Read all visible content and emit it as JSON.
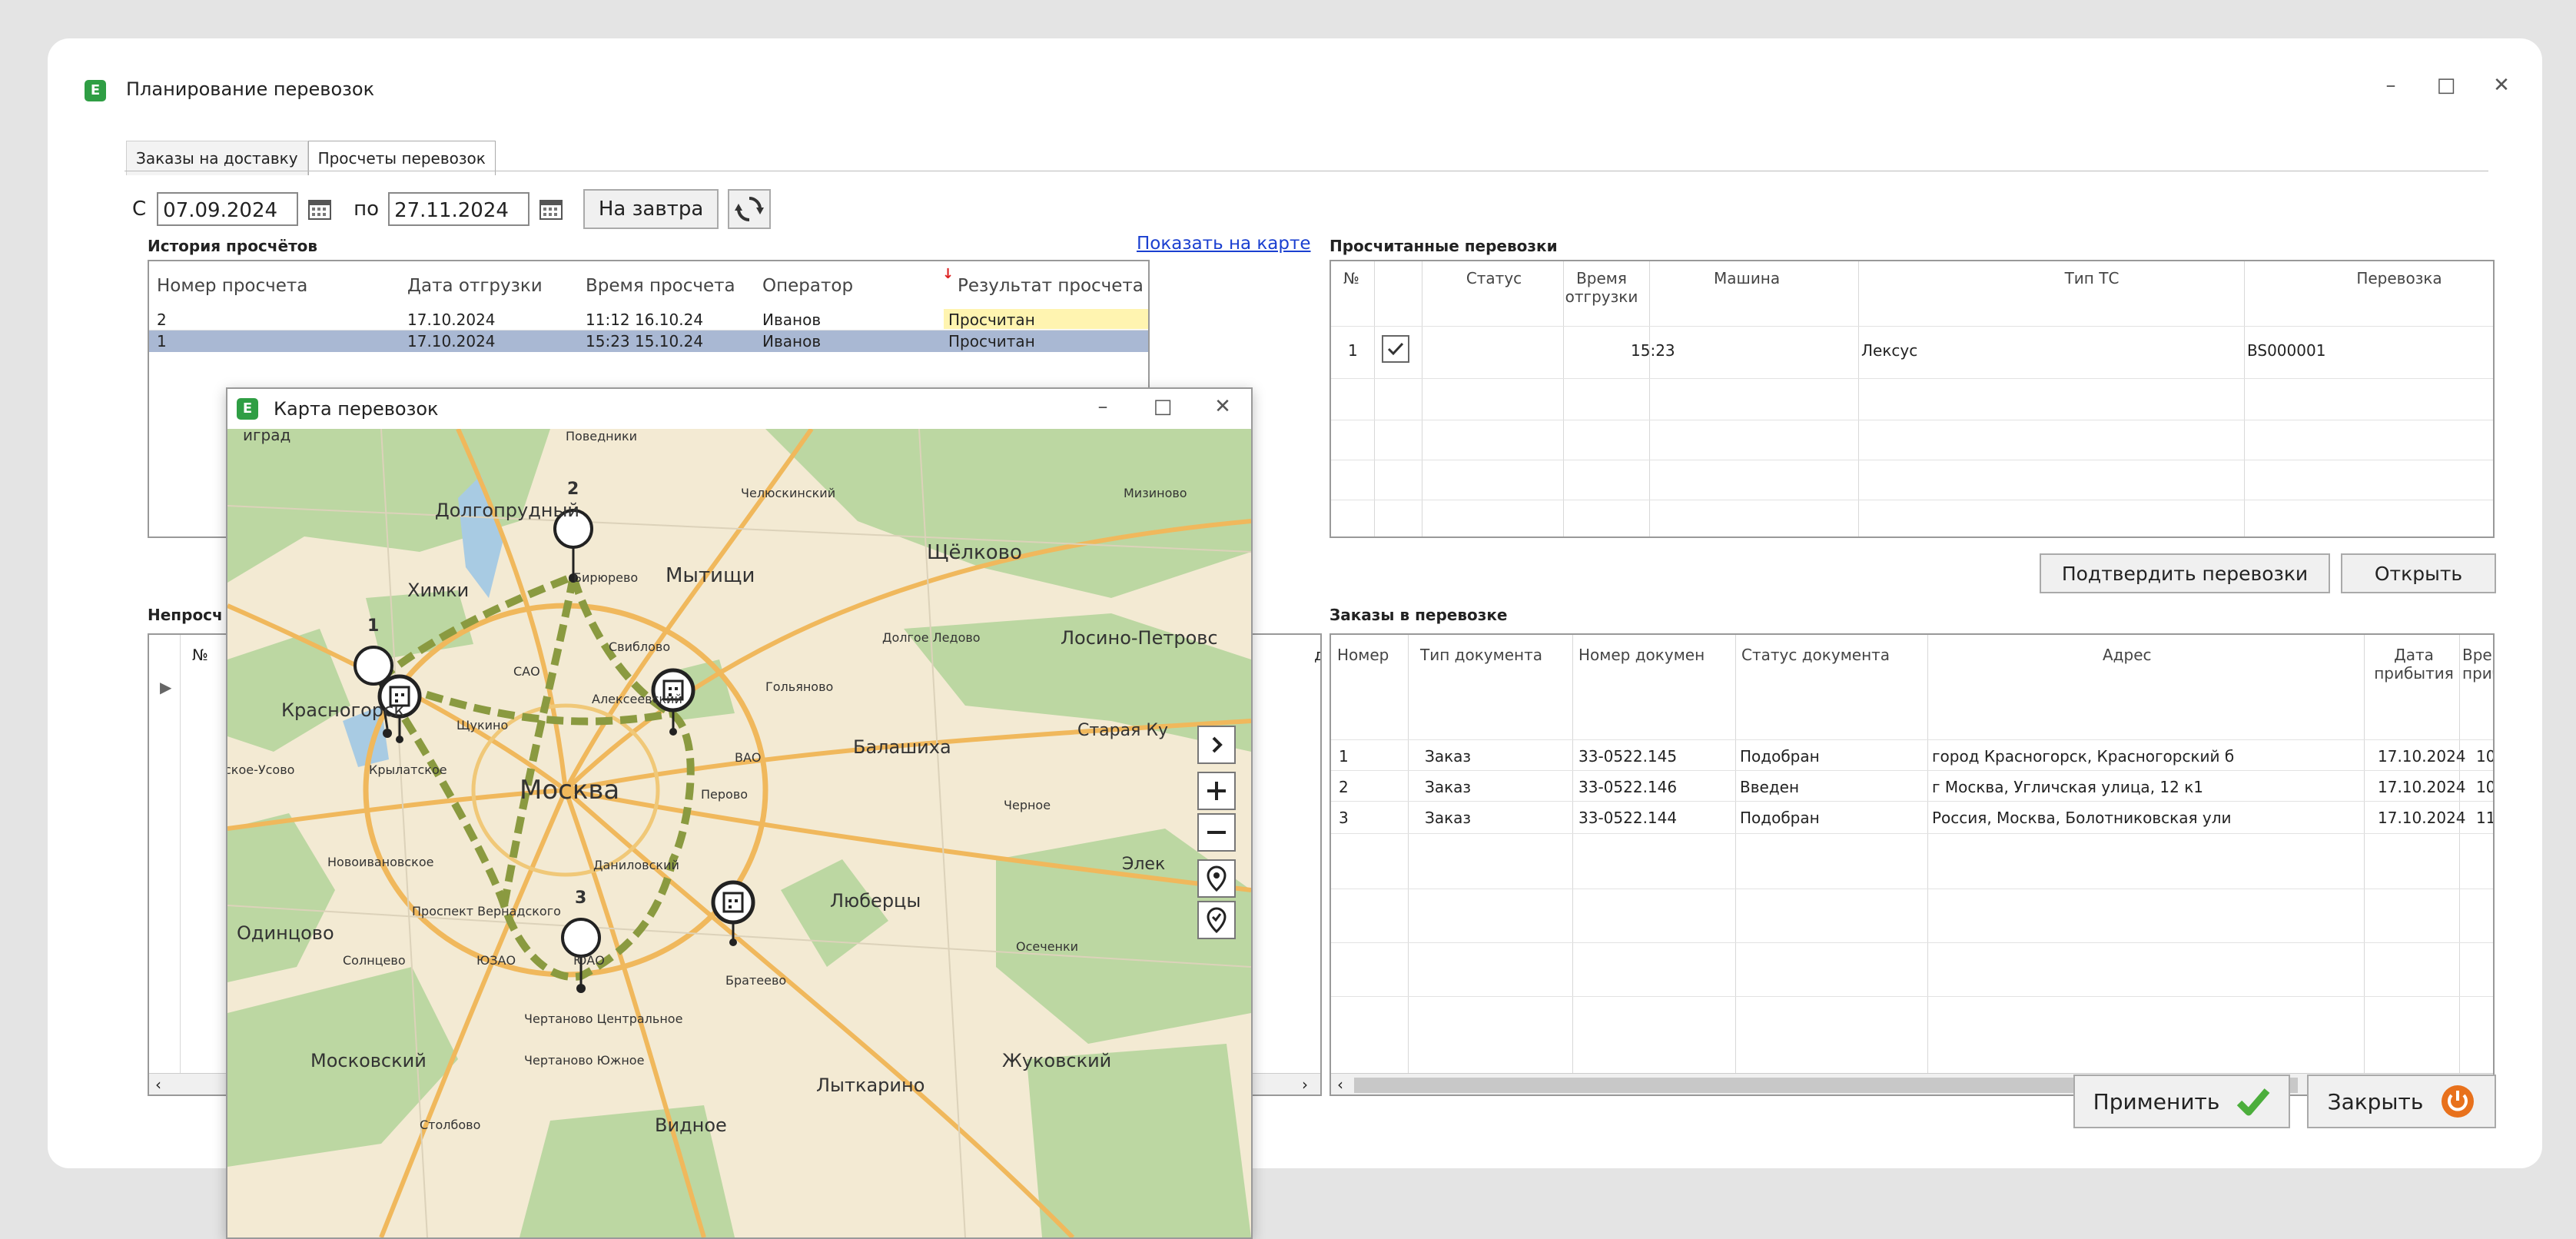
{
  "window": {
    "title": "Планирование перевозок",
    "minimize": "–",
    "maximize": "□",
    "close": "✕",
    "app_icon": "E"
  },
  "tabs": [
    {
      "label": "Заказы на доставку"
    },
    {
      "label": "Просчеты перевозок"
    }
  ],
  "filters": {
    "from_label": "С",
    "from_date": "07.09.2024",
    "to_label": "по",
    "to_date": "27.11.2024",
    "tomorrow_button": "На завтра"
  },
  "history": {
    "title": "История просчётов",
    "show_map_link": "Показать на карте",
    "columns": [
      "Номер просчета",
      "Дата отгрузки",
      "Время просчета",
      "Оператор",
      "Результат просчета"
    ],
    "sort_marker": "↓",
    "rows": [
      [
        "2",
        "17.10.2024",
        "11:12  16.10.24",
        "Иванов",
        "Просчитан"
      ],
      [
        "1",
        "17.10.2024",
        "15:23  15.10.24",
        "Иванов",
        "Просчитан"
      ]
    ]
  },
  "calculated": {
    "title": "Просчитанные перевозки",
    "columns": [
      "№",
      "Статус",
      "Время отгрузки",
      "Машина",
      "Тип ТС",
      "Перевозка"
    ],
    "rows": [
      {
        "n": "1",
        "time": "15:23",
        "vehicle_type": "Лексус",
        "transport": "BS000001"
      }
    ],
    "confirm_button": "Подтвердить перевозки",
    "open_button": "Открыть"
  },
  "uncalculated": {
    "title_partial": "Непросч",
    "col_n": "№",
    "col_addr_partial": "дрес"
  },
  "orders": {
    "title": "Заказы в перевозке",
    "columns": [
      "Номер",
      "Тип документа",
      "Номер докумен",
      "Статус документа",
      "Адрес",
      "Дата прибытия",
      "Время прибыт"
    ],
    "rows": [
      [
        "1",
        "Заказ",
        "33-0522.145",
        "Подобран",
        "город Красногорск, Красногорский б",
        "17.10.2024",
        "10"
      ],
      [
        "2",
        "Заказ",
        "33-0522.146",
        "Введен",
        "г Москва, Угличская улица, 12 к1",
        "17.10.2024",
        "10"
      ],
      [
        "3",
        "Заказ",
        "33-0522.144",
        "Подобран",
        "Россия, Москва, Болотниковская ули",
        "17.10.2024",
        "11"
      ]
    ]
  },
  "bottom": {
    "apply_button": "Применить",
    "close_button": "Закрыть"
  },
  "map_window": {
    "title": "Карта перевозок",
    "markers": [
      "1",
      "2",
      "3"
    ],
    "labels": {
      "moscow": "Москва",
      "khimki": "Химки",
      "dolgoprudny": "Долгопрудный",
      "mytishchi": "Мытищи",
      "shchelkovo": "Щёлково",
      "krasnogorsk": "Красногорск",
      "balashikha": "Балашиха",
      "lyubertsy": "Люберцы",
      "odintsovo": "Одинцово",
      "moskovsky": "Московский",
      "zhukovsky": "Жуковский",
      "lytkarino": "Лыткарино",
      "losino": "Лосино-Петровс",
      "staraya": "Старая Ку",
      "elek": "Элек",
      "vidnoe": "Видное",
      "chelyuskinsky": "Челюскинский",
      "mizinovo": "Мизиново",
      "dolgoe": "Долгое Ледово",
      "povedniki": "Поведники",
      "sviblovo": "Свиблово",
      "alekseevsky": "Алексеевский",
      "golyanovo": "Гольяново",
      "schukino": "Щукино",
      "vao": "ВАО",
      "sao": "САО",
      "perovo": "Перово",
      "chernoe": "Черное",
      "krylatskoe": "Крылатское",
      "novoivankovskoe": "Новоивановское",
      "prospekt": "Проспект Вернадского",
      "danilovsky": "Даниловский",
      "solntsevo": "Солнцево",
      "yuzao": "ЮЗАО",
      "yuao": "ЮАО",
      "bratеevo": "Братеево",
      "oseчenki": "Осеченки",
      "chertanovo_c": "Чертаново Центральное",
      "chertanovo_s": "Чертаново Южное",
      "stolbovo": "Столбово",
      "grad": "иград",
      "skoe": "ское-Усово",
      "beskudnikovo": "Бирюрево"
    }
  },
  "colors": {
    "selection": "#a9b8d3",
    "result_highlight": "#fff4b0",
    "link": "#1a3fd0",
    "route": "#8a9a40",
    "check_green": "#4cae3c",
    "power_orange": "#e8711c"
  }
}
